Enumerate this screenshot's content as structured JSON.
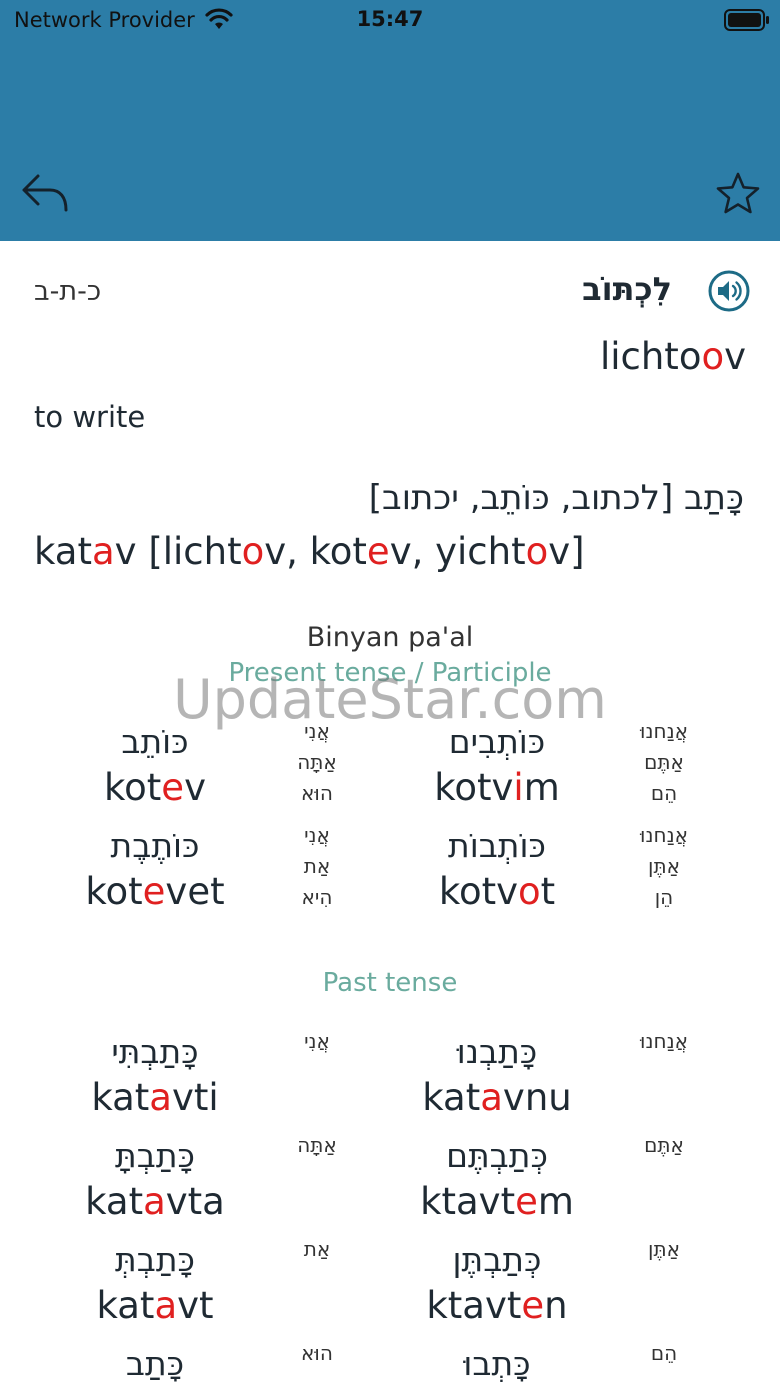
{
  "status_bar": {
    "carrier": "Network Provider",
    "time": "15:47"
  },
  "header": {
    "back_icon": "back-arrow-icon",
    "favorite_icon": "star-outline-icon",
    "color": "#2c7da7"
  },
  "verb": {
    "root": "כ-ת-ב",
    "hebrew": "לִכְתּוֹב",
    "translit": [
      {
        "t": "lichto"
      },
      {
        "t": "o",
        "r": true
      },
      {
        "t": "v"
      }
    ],
    "meaning": "to write",
    "forms_hebrew": "כָּתַב [לכתוב, כּוֹתֵב, יכתוב]",
    "forms_translit": [
      {
        "t": "kat"
      },
      {
        "t": "a",
        "r": true
      },
      {
        "t": "v [licht"
      },
      {
        "t": "o",
        "r": true
      },
      {
        "t": "v, kot"
      },
      {
        "t": "e",
        "r": true
      },
      {
        "t": "v, yicht"
      },
      {
        "t": "o",
        "r": true
      },
      {
        "t": "v]"
      }
    ]
  },
  "binyan": "Binyan pa'al",
  "present_title": "Present tense / Participle",
  "watermark": "UpdateStar.com",
  "past_title": "Past tense",
  "present_rows": [
    {
      "left": {
        "heb": "כּוֹתֵב",
        "tr": [
          {
            "t": "kot"
          },
          {
            "t": "e",
            "r": true
          },
          {
            "t": "v"
          }
        ]
      },
      "left_pron": [
        "אֲנִי",
        "אַתָּה",
        "הוּא"
      ],
      "right": {
        "heb": "כּוֹתְבִים",
        "tr": [
          {
            "t": "kotv"
          },
          {
            "t": "i",
            "r": true
          },
          {
            "t": "m"
          }
        ]
      },
      "right_pron": [
        "אֲנַחנוּ",
        "אַתֶּם",
        "הֵם"
      ]
    },
    {
      "left": {
        "heb": "כּוֹתֶבֶת",
        "tr": [
          {
            "t": "kot"
          },
          {
            "t": "e",
            "r": true
          },
          {
            "t": "vet"
          }
        ]
      },
      "left_pron": [
        "אֲנִי",
        "אַת",
        "הִיא"
      ],
      "right": {
        "heb": "כּוֹתְבוֹת",
        "tr": [
          {
            "t": "kotv"
          },
          {
            "t": "o",
            "r": true
          },
          {
            "t": "t"
          }
        ]
      },
      "right_pron": [
        "אֲנַחנוּ",
        "אַתֶּן",
        "הֵן"
      ]
    }
  ],
  "past_rows": [
    {
      "left": {
        "heb": "כָּתַבְתִּי",
        "tr": [
          {
            "t": "kat"
          },
          {
            "t": "a",
            "r": true
          },
          {
            "t": "vti"
          }
        ]
      },
      "left_pron": [
        "אֲנִי"
      ],
      "right": {
        "heb": "כָּתַבְנוּ",
        "tr": [
          {
            "t": "kat"
          },
          {
            "t": "a",
            "r": true
          },
          {
            "t": "vnu"
          }
        ]
      },
      "right_pron": [
        "אֲנַחנוּ"
      ]
    },
    {
      "left": {
        "heb": "כָּתַבְתָּ",
        "tr": [
          {
            "t": "kat"
          },
          {
            "t": "a",
            "r": true
          },
          {
            "t": "vta"
          }
        ]
      },
      "left_pron": [
        "אַתָּה"
      ],
      "right": {
        "heb": "כְּתַבְתֶּם",
        "tr": [
          {
            "t": "ktavt"
          },
          {
            "t": "e",
            "r": true
          },
          {
            "t": "m"
          }
        ]
      },
      "right_pron": [
        "אַתֶּם"
      ]
    },
    {
      "left": {
        "heb": "כָּתַבְתְּ",
        "tr": [
          {
            "t": "kat"
          },
          {
            "t": "a",
            "r": true
          },
          {
            "t": "vt"
          }
        ]
      },
      "left_pron": [
        "אַת"
      ],
      "right": {
        "heb": "כְּתַבְתֶּן",
        "tr": [
          {
            "t": "ktavt"
          },
          {
            "t": "e",
            "r": true
          },
          {
            "t": "n"
          }
        ]
      },
      "right_pron": [
        "אַתֶּן"
      ]
    },
    {
      "left": {
        "heb": "כָּתַב",
        "tr": []
      },
      "left_pron": [
        "הוּא"
      ],
      "right": {
        "heb": "כָּתְבוּ",
        "tr": []
      },
      "right_pron": [
        "הֵם"
      ]
    }
  ]
}
